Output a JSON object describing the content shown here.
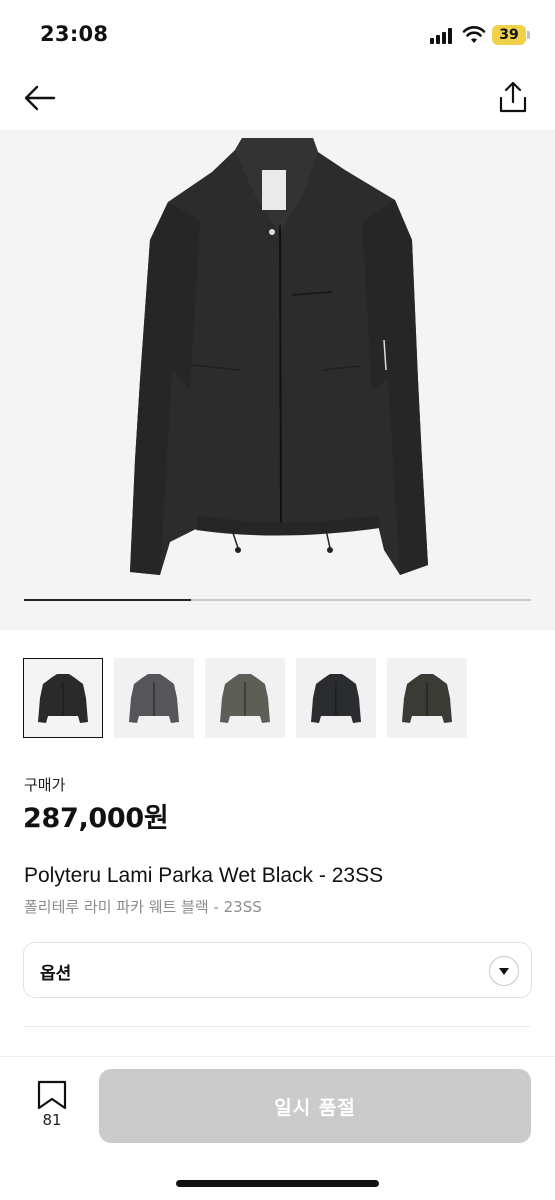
{
  "status_bar": {
    "time": "23:08",
    "battery": "39",
    "battery_color": "#f2d14a"
  },
  "nav": {
    "back_icon": "arrow-left-icon",
    "share_icon": "share-icon"
  },
  "gallery": {
    "image_count": 5,
    "active_index": 0,
    "progress_fraction": 0.33,
    "thumbnails": [
      {
        "color": "#2a2a2a"
      },
      {
        "color": "#55555a"
      },
      {
        "color": "#5d5f57"
      },
      {
        "color": "#2b2c30"
      },
      {
        "color": "#3a3b34"
      }
    ]
  },
  "price": {
    "label": "구매가",
    "value": "287,000원"
  },
  "product": {
    "name_en": "Polyteru Lami Parka Wet Black - 23SS",
    "name_ko": "폴리테루 라미 파카 웨트 블랙 - 23SS"
  },
  "option": {
    "label": "옵션",
    "chevron_icon": "chevron-down-icon"
  },
  "bottom_bar": {
    "bookmark_icon": "bookmark-icon",
    "bookmark_count": "81",
    "soldout_label": "일시 품절",
    "soldout_color": "#cbcbcb"
  }
}
